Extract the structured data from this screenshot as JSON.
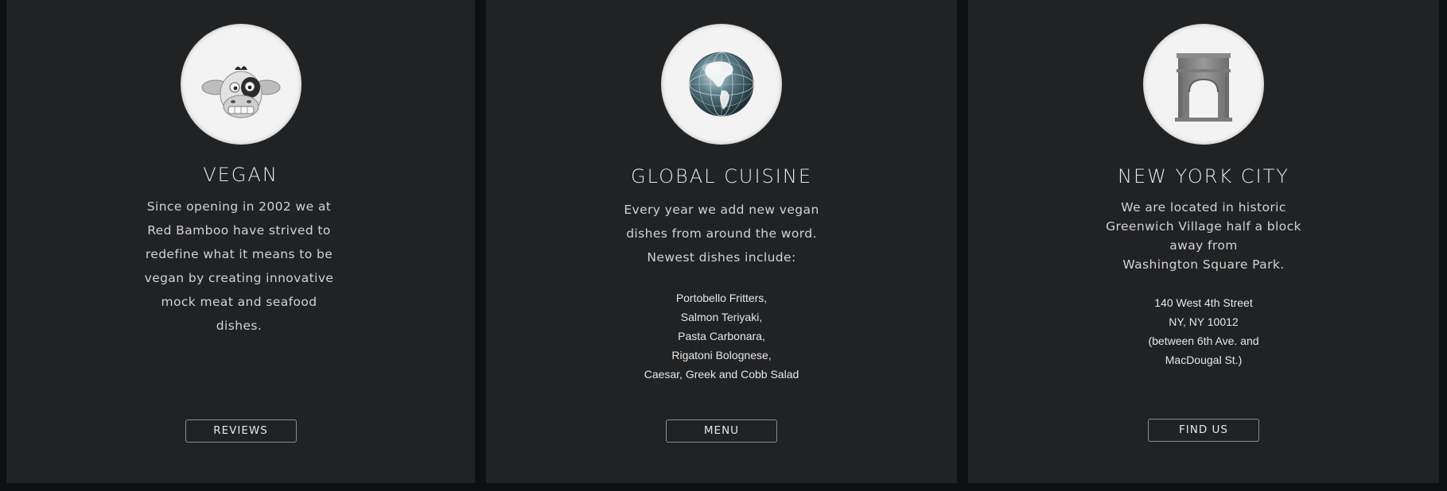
{
  "cards": {
    "vegan": {
      "title": "VEGAN",
      "description": [
        "Since opening in 2002 we at",
        "Red Bamboo have strived to",
        "redefine what it means to be",
        "vegan by creating innovative",
        "mock meat and seafood",
        "dishes."
      ],
      "button": "REVIEWS",
      "icon": "cow-icon"
    },
    "global": {
      "title": "GLOBAL CUISINE",
      "description": [
        "Every year we add new vegan",
        "dishes from around the word.",
        "Newest dishes include:"
      ],
      "dishes": [
        "Portobello Fritters,",
        "Salmon Teriyaki,",
        "Pasta Carbonara,",
        "Rigatoni Bolognese,",
        "Caesar, Greek and Cobb Salad"
      ],
      "button": "MENU",
      "icon": "globe-icon"
    },
    "nyc": {
      "title": "NEW YORK CITY",
      "description": [
        "We are located in historic",
        "Greenwich Village half a block",
        "away from",
        "Washington Square Park."
      ],
      "address": [
        "140 West 4th Street",
        "NY, NY 10012",
        "(between 6th Ave. and",
        "MacDougal St.)"
      ],
      "button": "FIND US",
      "icon": "arch-icon"
    }
  },
  "colors": {
    "page_background": "#0e0f10",
    "card_background": "#212224",
    "circle_background": "#f3f3f3",
    "text": "#e6e6e6"
  }
}
